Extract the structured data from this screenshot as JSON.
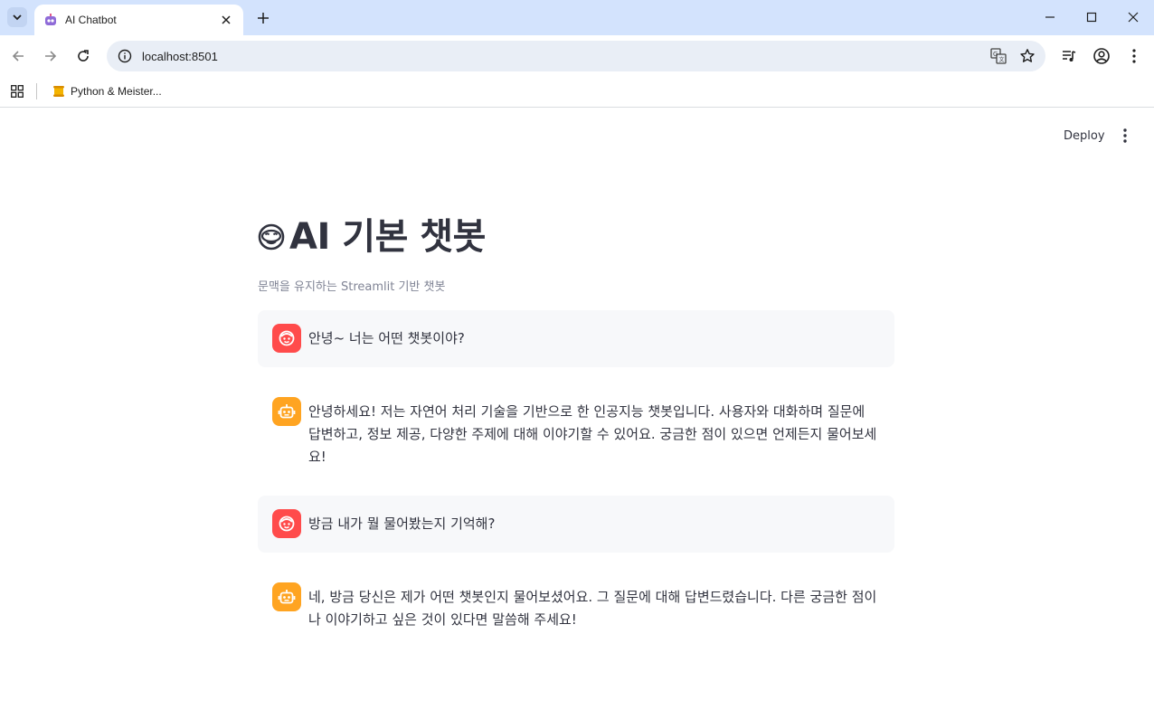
{
  "browser": {
    "tab_title": "AI Chatbot",
    "url": "localhost:8501",
    "bookmark_label": "Python & Meister..."
  },
  "app": {
    "deploy_label": "Deploy",
    "title": "AI 기본 챗봇",
    "caption": "문맥을 유지하는 Streamlit 기반 챗봇",
    "messages": [
      {
        "role": "user",
        "text": "안녕~ 너는 어떤 챗봇이야?"
      },
      {
        "role": "assistant",
        "text": "안녕하세요! 저는 자연어 처리 기술을 기반으로 한 인공지능 챗봇입니다. 사용자와 대화하며 질문에 답변하고, 정보 제공, 다양한 주제에 대해 이야기할 수 있어요. 궁금한 점이 있으면 언제든지 물어보세요!"
      },
      {
        "role": "user",
        "text": "방금 내가 뭘 물어봤는지 기억해?"
      },
      {
        "role": "assistant",
        "text": "네, 방금 당신은 제가 어떤 챗봇인지 물어보셨어요. 그 질문에 대해 답변드렸습니다. 다른 궁금한 점이나 이야기하고 싶은 것이 있다면 말씀해 주세요!"
      }
    ]
  },
  "colors": {
    "user_avatar": "#ff4b4b",
    "assistant_avatar": "#ffa421",
    "user_bubble": "#f7f8fa",
    "text": "#31333f",
    "caption": "#808495"
  }
}
